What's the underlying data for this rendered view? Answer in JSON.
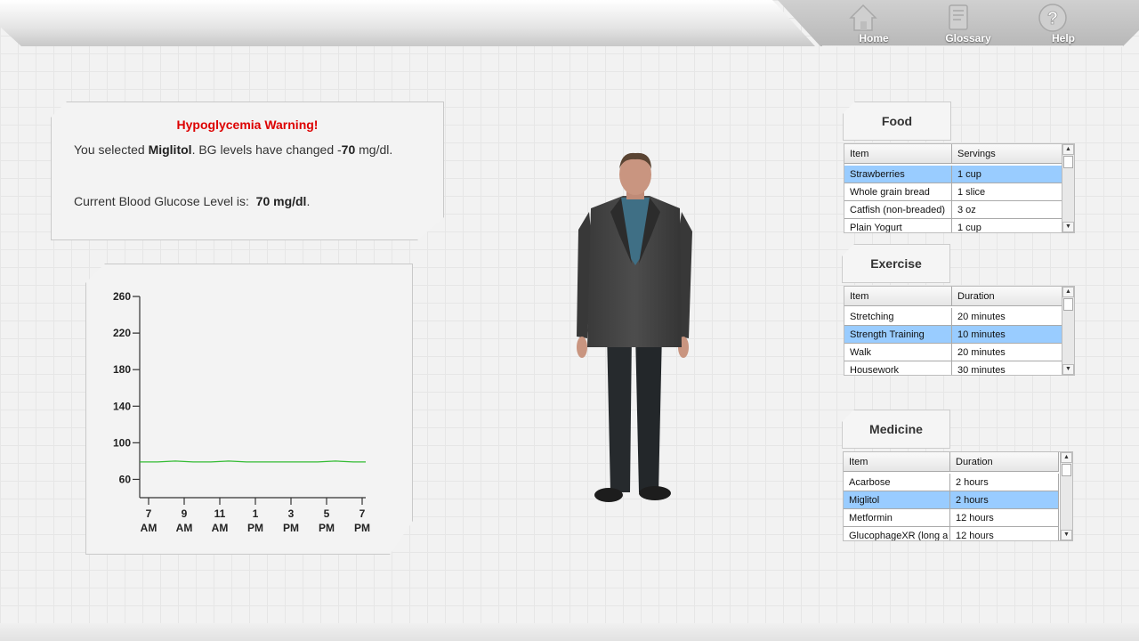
{
  "nav": {
    "home": "Home",
    "glossary": "Glossary",
    "help": "Help"
  },
  "warning": {
    "title": "Hypoglycemia Warning!",
    "line1_prefix": "You selected ",
    "line1_drug": "Miglitol",
    "line1_mid": ". BG levels have changed -",
    "line1_change": "70",
    "line1_suffix": " mg/dl.",
    "line2_prefix": "Current Blood Glucose Level is:  ",
    "line2_value": "70 mg/dl",
    "line2_suffix": "."
  },
  "chart_data": {
    "type": "line",
    "title": "",
    "xlabel": "",
    "ylabel": "",
    "y_ticks": [
      60,
      100,
      140,
      180,
      220,
      260
    ],
    "ylim": [
      40,
      260
    ],
    "x_ticks": [
      {
        "top": "7",
        "bottom": "AM"
      },
      {
        "top": "9",
        "bottom": "AM"
      },
      {
        "top": "11",
        "bottom": "AM"
      },
      {
        "top": "1",
        "bottom": "PM"
      },
      {
        "top": "3",
        "bottom": "PM"
      },
      {
        "top": "5",
        "bottom": "PM"
      },
      {
        "top": "7",
        "bottom": "PM"
      }
    ],
    "x_hours": [
      7,
      9,
      11,
      13,
      15,
      17,
      19
    ],
    "xlim": [
      6.5,
      19.2
    ],
    "series": [
      {
        "color": "#33bb33",
        "x": [
          6.5,
          7.5,
          8.5,
          9.5,
          10.5,
          11.5,
          12.5,
          13.5,
          14.5,
          15.5,
          16.5,
          17.5,
          18.5,
          19.2
        ],
        "values": [
          79,
          79,
          80,
          79,
          79,
          80,
          79,
          79,
          79,
          79,
          79,
          80,
          79,
          79
        ]
      }
    ]
  },
  "food": {
    "tab": "Food",
    "col1": "Item",
    "col2": "Servings",
    "rows": [
      {
        "item": "Strawberries",
        "value": "1 cup",
        "selected": true
      },
      {
        "item": "Whole grain bread",
        "value": "1 slice",
        "selected": false
      },
      {
        "item": "Catfish (non-breaded)",
        "value": "3 oz",
        "selected": false
      },
      {
        "item": "Plain Yogurt",
        "value": "1 cup",
        "selected": false
      }
    ]
  },
  "exercise": {
    "tab": "Exercise",
    "col1": "Item",
    "col2": "Duration",
    "rows": [
      {
        "item": "Stretching",
        "value": "20 minutes",
        "selected": false
      },
      {
        "item": "Strength Training",
        "value": "10 minutes",
        "selected": true
      },
      {
        "item": "Walk",
        "value": "20 minutes",
        "selected": false
      },
      {
        "item": "Housework",
        "value": "30 minutes",
        "selected": false
      }
    ]
  },
  "medicine": {
    "tab": "Medicine",
    "col1": "Item",
    "col2": "Duration",
    "rows": [
      {
        "item": "Acarbose",
        "value": "2 hours",
        "selected": false
      },
      {
        "item": "Miglitol",
        "value": "2 hours",
        "selected": true
      },
      {
        "item": "Metformin",
        "value": "12 hours",
        "selected": false
      },
      {
        "item": "GlucophageXR (long a",
        "value": "12 hours",
        "selected": false
      }
    ]
  },
  "colors": {
    "warning_title": "#dd0000",
    "selection": "#99ccff",
    "series": "#33bb33"
  }
}
